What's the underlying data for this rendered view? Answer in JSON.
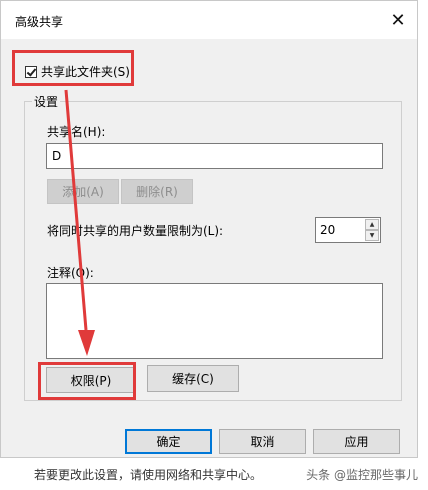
{
  "dialog": {
    "title": "高级共享",
    "close_glyph": "✕"
  },
  "share": {
    "checkbox_label": "共享此文件夹(S)",
    "checked": true
  },
  "settings": {
    "group_title": "设置",
    "share_name_label": "共享名(H):",
    "share_name_value": "D",
    "add_button": "添加(A)",
    "remove_button": "删除(R)",
    "user_limit_label": "将同时共享的用户数量限制为(L):",
    "user_limit_value": "20",
    "comment_label": "注释(O):",
    "comment_value": "",
    "permissions_button": "权限(P)",
    "cache_button": "缓存(C)"
  },
  "footer": {
    "ok_button": "确定",
    "cancel_button": "取消",
    "apply_button": "应用"
  },
  "background": {
    "partial_text": "若要更改此设置，请使用网络和共享中心。"
  },
  "watermark": "头条 @监控那些事儿",
  "colors": {
    "highlight": "#e03a3a",
    "dialog_bg": "#f0f0f0",
    "default_button_border": "#0078d7"
  }
}
